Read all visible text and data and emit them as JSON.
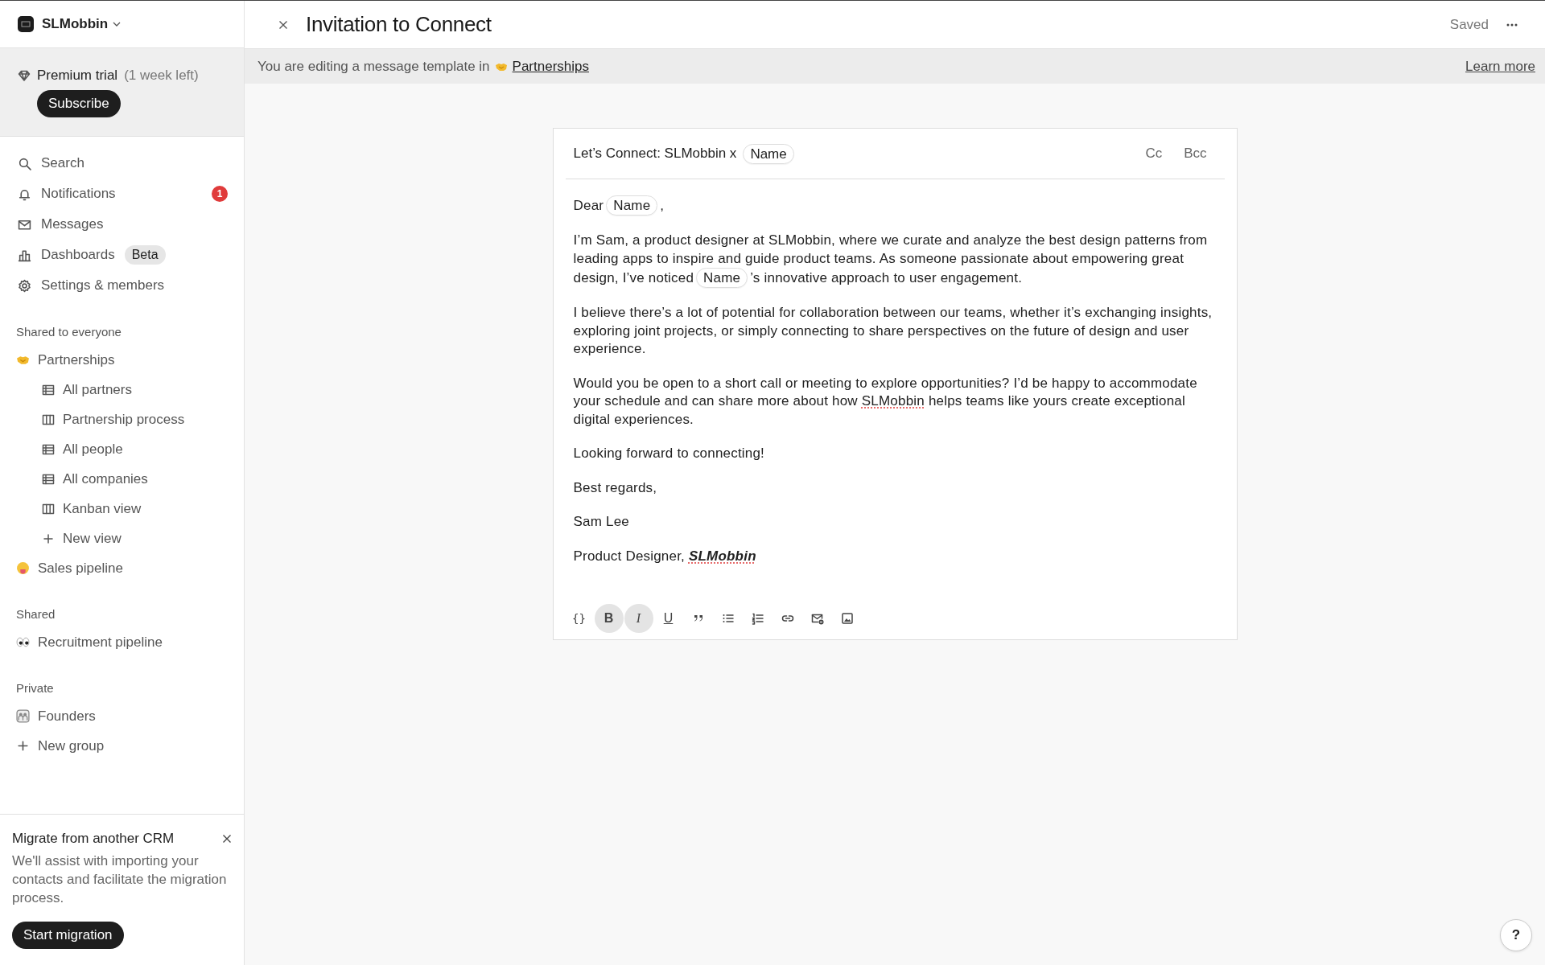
{
  "workspace": {
    "name": "SLMobbin"
  },
  "trial": {
    "label": "Premium trial",
    "note": "(1 week left)",
    "button": "Subscribe"
  },
  "nav": [
    {
      "kind": "search",
      "label": "Search"
    },
    {
      "kind": "bell",
      "label": "Notifications",
      "badge": "1"
    },
    {
      "kind": "mail",
      "label": "Messages"
    },
    {
      "kind": "chart",
      "label": "Dashboards",
      "tag": "Beta"
    },
    {
      "kind": "gear",
      "label": "Settings & members"
    }
  ],
  "sections": [
    {
      "title": "Shared to everyone",
      "items": [
        {
          "kind": "handshake",
          "label": "Partnerships",
          "children": [
            {
              "kind": "table",
              "label": "All partners"
            },
            {
              "kind": "board",
              "label": "Partnership process"
            },
            {
              "kind": "table",
              "label": "All people"
            },
            {
              "kind": "table",
              "label": "All companies"
            },
            {
              "kind": "board",
              "label": "Kanban view"
            },
            {
              "kind": "plus",
              "label": "New view"
            }
          ]
        },
        {
          "kind": "face",
          "label": "Sales pipeline"
        }
      ]
    },
    {
      "title": "Shared",
      "items": [
        {
          "kind": "eyes",
          "label": "Recruitment pipeline"
        }
      ]
    },
    {
      "title": "Private",
      "items": [
        {
          "kind": "group",
          "label": "Founders"
        },
        {
          "kind": "plus",
          "label": "New group"
        }
      ]
    }
  ],
  "promo": {
    "title": "Migrate from another CRM",
    "text": "We'll assist with importing your contacts and facilitate the migration process.",
    "button": "Start migration"
  },
  "header": {
    "title": "Invitation to Connect",
    "status": "Saved"
  },
  "banner": {
    "text": "You are editing a message template in",
    "link": "Partnerships",
    "learn_more": "Learn more"
  },
  "email": {
    "subject": [
      {
        "kind": "text",
        "text": "Let’s Connect: SLMobbin x"
      },
      {
        "kind": "chip",
        "text": "Name"
      }
    ],
    "cc": "Cc",
    "bcc": "Bcc",
    "paragraphs": [
      {
        "parts": [
          {
            "kind": "text",
            "text": "Dear"
          },
          {
            "kind": "chip",
            "text": "Name"
          },
          {
            "kind": "text",
            "text": ","
          }
        ]
      },
      {
        "parts": [
          {
            "kind": "text",
            "text": "I’m Sam, a product designer at SLMobbin, where we curate and analyze the best design patterns from leading apps to inspire and guide product teams. As someone passionate about empowering great design, I’ve noticed"
          },
          {
            "kind": "chip",
            "text": "Name"
          },
          {
            "kind": "text",
            "text": "’s innovative approach to user engagement."
          }
        ]
      },
      {
        "parts": [
          {
            "kind": "text",
            "text": "I believe there’s a lot of potential for collaboration between our teams, whether it’s exchanging insights, exploring joint projects, or simply connecting to share perspectives on the future of design and user experience."
          }
        ]
      },
      {
        "parts": [
          {
            "kind": "text",
            "text": "Would you be open to a short call or meeting to explore opportunities? I’d be happy to accommodate your schedule and can share more about how"
          },
          {
            "kind": "misspelled",
            "text": "SLMobbin"
          },
          {
            "kind": "text",
            "text": "helps teams like yours create exceptional digital experiences."
          }
        ]
      },
      {
        "parts": [
          {
            "kind": "text",
            "text": "Looking forward to connecting!"
          }
        ]
      },
      {
        "parts": [
          {
            "kind": "text",
            "text": "Best regards,"
          }
        ]
      },
      {
        "parts": [
          {
            "kind": "text",
            "text": "Sam Lee"
          }
        ]
      },
      {
        "parts": [
          {
            "kind": "text",
            "text": "Product Designer,"
          },
          {
            "kind": "emphasis",
            "text": "SLMobbin"
          }
        ]
      }
    ]
  },
  "toolbar": [
    {
      "kind": "variable",
      "label": "{}",
      "active": false
    },
    {
      "kind": "bold",
      "label": "B",
      "active": true
    },
    {
      "kind": "italic",
      "label": "I",
      "active": true
    },
    {
      "kind": "underline",
      "label": "U",
      "active": false
    },
    {
      "kind": "quote",
      "active": false
    },
    {
      "kind": "bullets",
      "active": false
    },
    {
      "kind": "numbers",
      "active": false
    },
    {
      "kind": "link",
      "active": false
    },
    {
      "kind": "mail",
      "active": false
    },
    {
      "kind": "image",
      "active": false
    }
  ],
  "help": "?"
}
